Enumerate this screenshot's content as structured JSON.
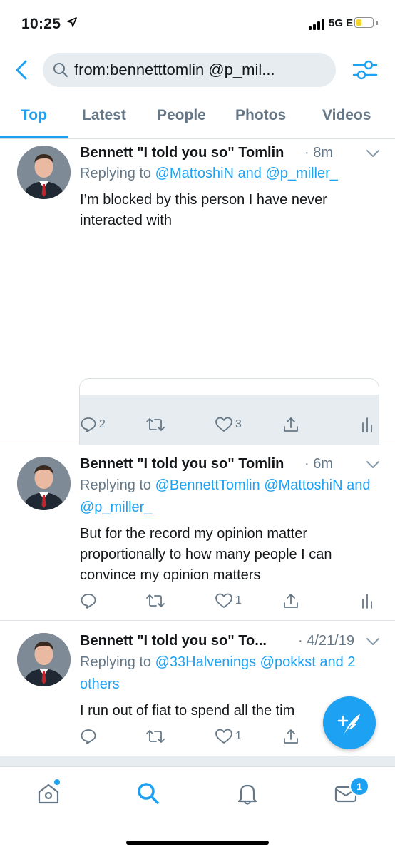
{
  "status_bar": {
    "time": "10:25",
    "network": "5G E",
    "battery_level": 0.35,
    "battery_color": "#f5d328"
  },
  "search": {
    "query": "from:bennetttomlin @p_mil..."
  },
  "tabs": [
    {
      "label": "Top",
      "active": true
    },
    {
      "label": "Latest",
      "active": false
    },
    {
      "label": "People",
      "active": false
    },
    {
      "label": "Photos",
      "active": false
    },
    {
      "label": "Videos",
      "active": false
    }
  ],
  "tweets": [
    {
      "name": "Bennett \"I told you so\" Tomlin",
      "time": "· 8m",
      "replying_prefix": "Replying to ",
      "mentions_a": "@MattoshiN",
      "joiner": " and ",
      "mentions_b": "@p_miller_",
      "body": "I’m blocked by this person I have never interacted with",
      "replies": "2",
      "retweets": "",
      "likes": "3"
    },
    {
      "name": "Bennett \"I told you so\" Tomlin",
      "time": "· 6m",
      "replying_prefix": "Replying to ",
      "mentions_a": "@BennettTomlin @MattoshiN",
      "joiner": " and ",
      "mentions_b": "@p_miller_",
      "body": "But for the record my opinion matter proportionally to how many people I can convince my opinion matters",
      "replies": "",
      "retweets": "",
      "likes": "1"
    },
    {
      "name": "Bennett \"I told you so\" To...",
      "time": "· 4/21/19",
      "replying_prefix": "Replying to ",
      "mentions_a": "@33Halvenings @pokkst and 2 others",
      "joiner": "",
      "mentions_b": "",
      "body": "I run out of fiat to spend all the tim",
      "replies": "",
      "retweets": "",
      "likes": "1"
    }
  ],
  "tabbar": {
    "items": [
      "home-icon",
      "search-icon",
      "notifications-icon",
      "messages-icon"
    ],
    "messages_badge": "1",
    "accent": "#1da1f2"
  }
}
